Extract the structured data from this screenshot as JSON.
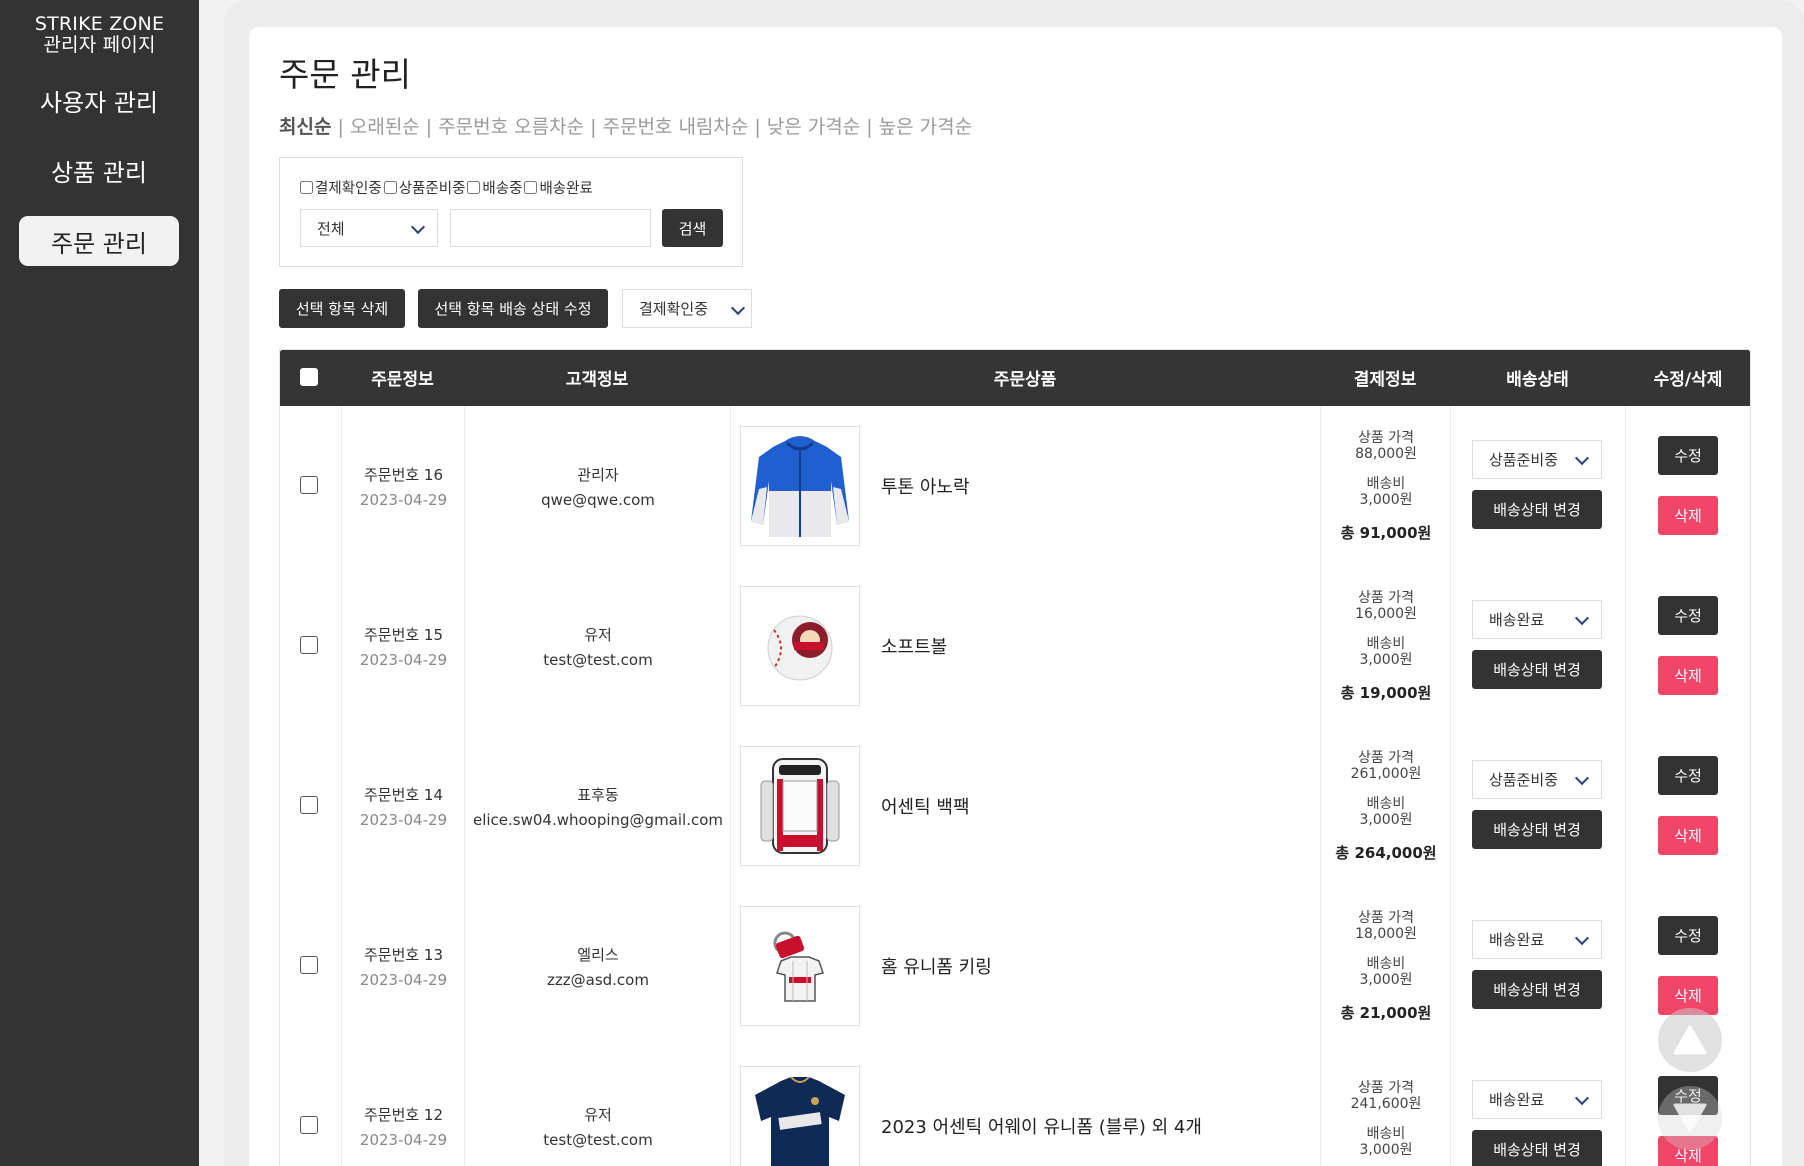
{
  "sidebar": {
    "brand_line1": "STRIKE ZONE",
    "brand_line2": "관리자 페이지",
    "items": [
      {
        "label": "사용자 관리",
        "active": false
      },
      {
        "label": "상품 관리",
        "active": false
      },
      {
        "label": "주문 관리",
        "active": true
      }
    ]
  },
  "page": {
    "title": "주문 관리",
    "sort_options": [
      "최신순",
      "오래된순",
      "주문번호 오름차순",
      "주문번호 내림차순",
      "낮은 가격순",
      "높은 가격순"
    ],
    "active_sort": "최신순",
    "sort_separator": "|"
  },
  "filter": {
    "checkboxes": [
      "결제확인중",
      "상품준비중",
      "배송중",
      "배송완료"
    ],
    "search_field_select": "전체",
    "search_value": "",
    "search_button": "검색"
  },
  "bulk": {
    "delete_button": "선택 항목 삭제",
    "update_button": "선택 항목 배송 상태 수정",
    "status_select": "결제확인중"
  },
  "table": {
    "headers": {
      "order_info": "주문정보",
      "customer_info": "고객정보",
      "product": "주문상품",
      "payment": "결제정보",
      "delivery": "배송상태",
      "actions": "수정/삭제"
    },
    "labels": {
      "price": "상품 가격",
      "shipping": "배송비",
      "change_status": "배송상태 변경",
      "edit": "수정",
      "delete": "삭제"
    },
    "rows": [
      {
        "order_no": "주문번호 16",
        "date": "2023-04-29",
        "name": "관리자",
        "email": "qwe@qwe.com",
        "product": "투톤 아노락",
        "image": "jacket",
        "price": "88,000원",
        "shipping": "3,000원",
        "total": "총 91,000원",
        "status": "상품준비중"
      },
      {
        "order_no": "주문번호 15",
        "date": "2023-04-29",
        "name": "유저",
        "email": "test@test.com",
        "product": "소프트볼",
        "image": "baseball",
        "price": "16,000원",
        "shipping": "3,000원",
        "total": "총 19,000원",
        "status": "배송완료"
      },
      {
        "order_no": "주문번호 14",
        "date": "2023-04-29",
        "name": "표후동",
        "email": "elice.sw04.whooping@gmail.com",
        "product": "어센틱 백팩",
        "image": "backpack",
        "price": "261,000원",
        "shipping": "3,000원",
        "total": "총 264,000원",
        "status": "상품준비중"
      },
      {
        "order_no": "주문번호 13",
        "date": "2023-04-29",
        "name": "엘리스",
        "email": "zzz@asd.com",
        "product": "홈 유니폼 키링",
        "image": "keyring",
        "price": "18,000원",
        "shipping": "3,000원",
        "total": "총 21,000원",
        "status": "배송완료"
      },
      {
        "order_no": "주문번호 12",
        "date": "2023-04-29",
        "name": "유저",
        "email": "test@test.com",
        "product": "2023 어센틱 어웨이 유니폼 (블루) 외 4개",
        "image": "jersey",
        "price": "241,600원",
        "shipping": "3,000원",
        "total": "",
        "status": "배송완료"
      }
    ]
  },
  "colors": {
    "sidebar": "#333333",
    "dark_button": "#333333",
    "delete_button": "#f14668",
    "chevron": "#2a3f7a"
  }
}
